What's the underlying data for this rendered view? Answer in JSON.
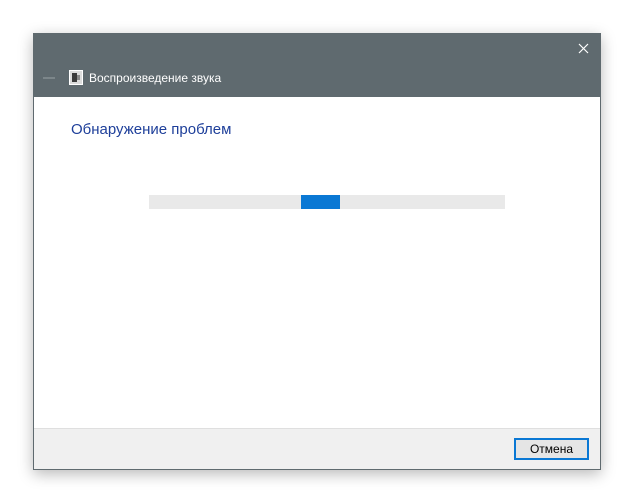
{
  "window": {
    "title": "Воспроизведение звука",
    "icons": {
      "close": "close-icon",
      "back": "back-arrow-icon",
      "app": "sound-troubleshooter-icon"
    }
  },
  "main": {
    "heading": "Обнаружение проблем",
    "progress": {
      "indeterminate": true,
      "chunk_position_fraction": 0.48
    }
  },
  "footer": {
    "cancel_label": "Отмена"
  },
  "colors": {
    "titlebar": "#5f6a6f",
    "heading": "#1e3f9a",
    "accent": "#0a78d4",
    "progress_track": "#e9e9e9",
    "footer_bg": "#f0f0f0"
  }
}
